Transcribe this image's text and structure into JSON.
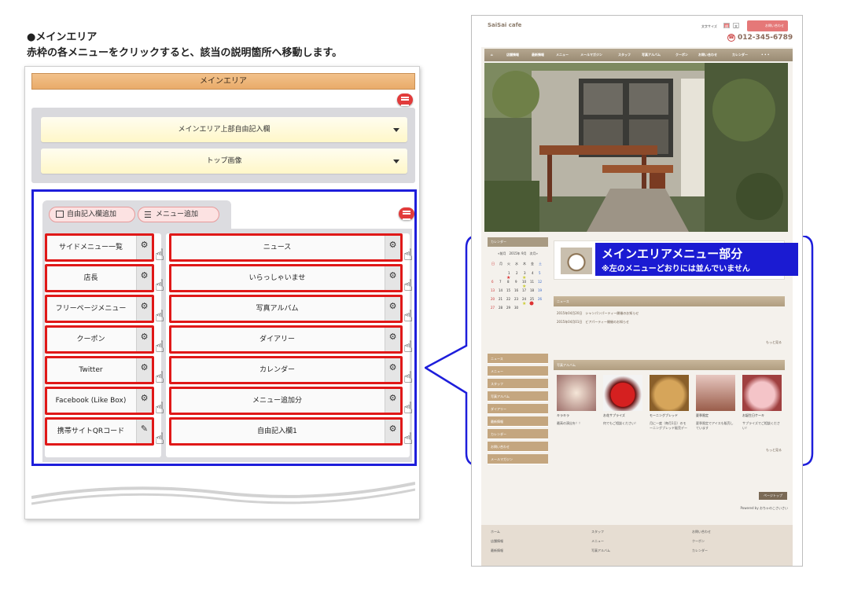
{
  "heading": {
    "line1": "●メインエリア",
    "line2": "赤枠の各メニューをクリックすると、該当の説明箇所へ移動します。"
  },
  "panel": {
    "title": "メインエリア",
    "top_bars": [
      "メインエリア上部自由記入欄",
      "トップ画像"
    ],
    "tabs": {
      "free_add": "自由記入欄追加",
      "menu_add": "メニュー追加"
    },
    "left_items": [
      "サイドメニュー一覧",
      "店長",
      "フリーページメニュー",
      "クーポン",
      "Twitter",
      "Facebook (Like Box)",
      "携帯サイトQRコード"
    ],
    "right_items": [
      "ニュース",
      "いらっしゃいませ",
      "写真アルバム",
      "ダイアリー",
      "カレンダー",
      "メニュー追加分",
      "自由記入欄1"
    ]
  },
  "site": {
    "logo": "SaiSai cafe",
    "font_size_label": "文字サイズ",
    "font_size_buttons": [
      "標準",
      "大"
    ],
    "contact": "お問い合わせ",
    "phone": "012-345-6789",
    "gnav": [
      "店舗情報",
      "最新情報",
      "メニュー",
      "メールマガジン",
      "スタッフ",
      "写真アルバム",
      "クーポン",
      "お問い合わせ",
      "カレンダー",
      "• • •"
    ],
    "calendar_title": "カレンダー",
    "calendar_header": "«前月　2015年 9月　次月»",
    "weekdays": [
      "日",
      "月",
      "火",
      "水",
      "木",
      "金",
      "土"
    ],
    "side_nav": [
      "ニュース",
      "メニュー",
      "スタッフ",
      "写真アルバム",
      "ダイアリー",
      "最新情報",
      "カレンダー",
      "お問い合わせ",
      "メールマガジン"
    ],
    "news_title": "ニュース",
    "news": [
      "2015年04月20日　シャンパンパーティー開催のお知らせ",
      "2015年04月01日　ビアパーティー開催のお知らせ"
    ],
    "more": "もっと見る",
    "album_title": "写真アルバム",
    "album": [
      {
        "cap": "キラキラ",
        "sub": "最高の演出を！！"
      },
      {
        "cap": "お花サプライズ",
        "sub": "何でもご相談ください！"
      },
      {
        "cap": "モーニングブレッド",
        "sub": "月に一度（毎月1日）のモーニングブレッド販売デー"
      },
      {
        "cap": "夏季限定",
        "sub": "夏季限定でアイスも販売しています"
      },
      {
        "cap": "お誕生日ケーキ",
        "sub": "サプライズでご相談ください！"
      }
    ],
    "more2": "もっと見る",
    "pagetop": "ページトップ",
    "powered": "Powered by おちゃのこさいさい",
    "footer": [
      "ホーム",
      "店舗情報",
      "最新情報",
      "スタッフ",
      "メニュー",
      "写真アルバム",
      "お問い合わせ",
      "クーポン",
      "カレンダー"
    ]
  },
  "callout": {
    "title": "メインエリアメニュー部分",
    "note": "※左のメニューどおりには並んでいません"
  },
  "colors": {
    "red_frame": "#e01818",
    "blue_frame": "#1e1edb",
    "panel_title": "#eab070"
  }
}
